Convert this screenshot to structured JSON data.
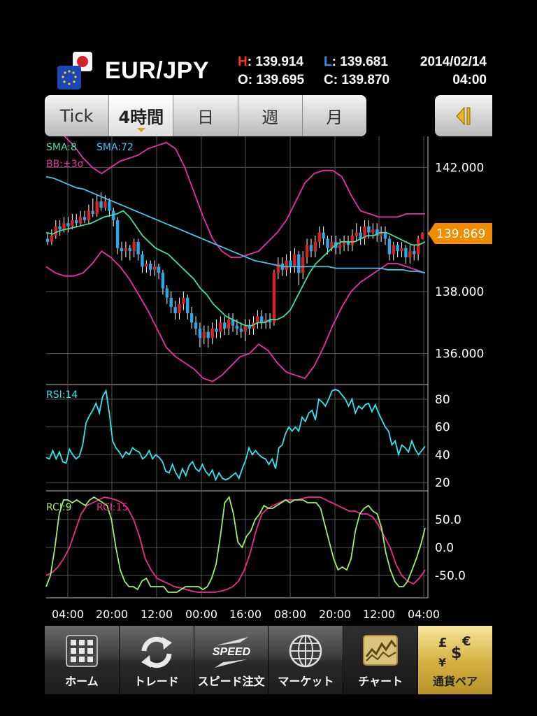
{
  "header": {
    "pair": "EUR/JPY",
    "high_key": "H",
    "high_value": ": 139.914",
    "low_key": "L",
    "low_value": ": 139.681",
    "open_key": "O",
    "open_value": ": 139.695",
    "close_key": "C",
    "close_value": ": 139.870",
    "date": "2014/02/14",
    "time": "04:00",
    "colors": {
      "high": "#ff2a2a",
      "low": "#2a8cff"
    }
  },
  "tabs": [
    {
      "label": "Tick",
      "active": false
    },
    {
      "label": "4時間",
      "active": true
    },
    {
      "label": "日",
      "active": false
    },
    {
      "label": "週",
      "active": false
    },
    {
      "label": "月",
      "active": false
    }
  ],
  "side_button_icon": "collapse-left-icon",
  "chart_data": [
    {
      "type": "candlestick",
      "panel": "price",
      "legend": [
        "SMA:8",
        "SMA:72",
        "BB:±3σ"
      ],
      "legend_colors": [
        "#3fe0a0",
        "#46c4ee",
        "#ee2ea8"
      ],
      "ylim": [
        135.0,
        143.0
      ],
      "yticks": [
        136.0,
        138.0,
        142.0
      ],
      "ytick_labels": [
        "136.000",
        "138.000",
        "142.000"
      ],
      "current_price": "139.869",
      "current_value": 139.869,
      "candles": [
        [
          139.7,
          139.6,
          139.9,
          139.5
        ],
        [
          139.6,
          139.8,
          140.0,
          139.5
        ],
        [
          139.8,
          140.1,
          140.3,
          139.7
        ],
        [
          140.1,
          140.0,
          140.3,
          139.8
        ],
        [
          140.0,
          140.2,
          140.4,
          139.9
        ],
        [
          140.2,
          140.1,
          140.4,
          139.9
        ],
        [
          140.1,
          140.3,
          140.5,
          140.0
        ],
        [
          140.3,
          140.2,
          140.5,
          140.1
        ],
        [
          140.2,
          140.4,
          140.6,
          140.1
        ],
        [
          140.4,
          140.3,
          140.6,
          140.2
        ],
        [
          140.3,
          140.6,
          140.8,
          140.2
        ],
        [
          140.6,
          140.5,
          141.0,
          140.4
        ],
        [
          140.5,
          140.9,
          141.1,
          140.4
        ],
        [
          140.9,
          140.7,
          141.2,
          140.6
        ],
        [
          140.7,
          140.9,
          141.1,
          140.6
        ],
        [
          140.9,
          140.6,
          141.0,
          140.4
        ],
        [
          140.6,
          140.3,
          140.7,
          140.1
        ],
        [
          140.3,
          139.4,
          140.4,
          139.2
        ],
        [
          139.4,
          139.3,
          139.6,
          139.0
        ],
        [
          139.3,
          139.4,
          139.6,
          139.1
        ],
        [
          139.4,
          139.3,
          139.5,
          139.0
        ],
        [
          139.3,
          139.6,
          139.7,
          139.1
        ],
        [
          139.6,
          139.2,
          139.7,
          139.0
        ],
        [
          139.2,
          138.8,
          139.3,
          138.6
        ],
        [
          138.8,
          138.9,
          139.0,
          138.6
        ],
        [
          138.9,
          138.7,
          139.0,
          138.5
        ],
        [
          138.7,
          138.8,
          139.0,
          138.5
        ],
        [
          138.8,
          138.6,
          138.9,
          138.4
        ],
        [
          138.6,
          138.1,
          138.7,
          137.9
        ],
        [
          138.1,
          137.8,
          138.2,
          137.6
        ],
        [
          137.8,
          137.5,
          138.0,
          137.3
        ],
        [
          137.5,
          137.3,
          137.7,
          137.1
        ],
        [
          137.3,
          137.6,
          137.8,
          137.1
        ],
        [
          137.6,
          137.8,
          138.0,
          137.4
        ],
        [
          137.8,
          137.3,
          137.9,
          137.1
        ],
        [
          137.3,
          137.0,
          137.5,
          136.8
        ],
        [
          137.0,
          136.8,
          137.2,
          136.6
        ],
        [
          136.8,
          136.5,
          137.0,
          136.2
        ],
        [
          136.5,
          136.7,
          136.9,
          136.3
        ],
        [
          136.7,
          136.5,
          136.9,
          136.2
        ],
        [
          136.5,
          136.8,
          137.0,
          136.3
        ],
        [
          136.8,
          136.7,
          137.1,
          136.5
        ],
        [
          136.7,
          137.0,
          137.2,
          136.5
        ],
        [
          137.0,
          136.8,
          137.2,
          136.6
        ],
        [
          136.8,
          137.1,
          137.3,
          136.6
        ],
        [
          137.1,
          136.9,
          137.3,
          136.7
        ],
        [
          136.9,
          136.8,
          137.1,
          136.6
        ],
        [
          136.8,
          136.7,
          137.0,
          136.5
        ],
        [
          136.7,
          136.9,
          137.1,
          136.4
        ],
        [
          136.9,
          136.8,
          137.1,
          136.6
        ],
        [
          136.8,
          137.0,
          137.2,
          136.6
        ],
        [
          137.0,
          137.2,
          137.4,
          136.8
        ],
        [
          137.2,
          137.0,
          137.4,
          136.8
        ],
        [
          137.0,
          137.1,
          137.3,
          136.8
        ],
        [
          137.1,
          137.0,
          137.3,
          136.8
        ],
        [
          137.0,
          138.6,
          138.7,
          136.9
        ],
        [
          138.6,
          138.9,
          139.1,
          138.4
        ],
        [
          138.9,
          138.7,
          139.1,
          138.5
        ],
        [
          138.7,
          139.0,
          139.2,
          138.5
        ],
        [
          139.0,
          138.8,
          139.3,
          138.6
        ],
        [
          138.8,
          139.2,
          139.4,
          138.6
        ],
        [
          139.2,
          138.6,
          139.3,
          138.2
        ],
        [
          138.6,
          139.1,
          139.3,
          138.4
        ],
        [
          139.1,
          139.5,
          139.7,
          138.9
        ],
        [
          139.5,
          139.3,
          139.7,
          139.1
        ],
        [
          139.3,
          139.6,
          139.8,
          139.1
        ],
        [
          139.6,
          139.9,
          140.1,
          139.4
        ],
        [
          139.9,
          139.7,
          140.1,
          139.5
        ],
        [
          139.7,
          139.4,
          139.8,
          139.2
        ],
        [
          139.4,
          139.6,
          139.8,
          139.3
        ],
        [
          139.6,
          139.4,
          139.8,
          139.2
        ],
        [
          139.4,
          139.5,
          139.7,
          139.2
        ],
        [
          139.5,
          139.6,
          139.8,
          139.3
        ],
        [
          139.6,
          139.5,
          139.8,
          139.3
        ],
        [
          139.5,
          139.8,
          140.0,
          139.3
        ],
        [
          139.8,
          139.9,
          140.2,
          139.6
        ],
        [
          139.9,
          139.7,
          140.1,
          139.5
        ],
        [
          139.7,
          140.1,
          140.3,
          139.5
        ],
        [
          140.1,
          139.9,
          140.3,
          139.7
        ],
        [
          139.9,
          140.0,
          140.2,
          139.7
        ],
        [
          140.0,
          139.8,
          140.2,
          139.6
        ],
        [
          139.8,
          139.9,
          140.1,
          139.6
        ],
        [
          139.9,
          139.7,
          140.1,
          139.5
        ],
        [
          139.7,
          139.2,
          139.8,
          139.0
        ],
        [
          139.2,
          139.5,
          139.6,
          139.0
        ],
        [
          139.5,
          139.3,
          139.6,
          139.1
        ],
        [
          139.3,
          139.4,
          139.6,
          139.1
        ],
        [
          139.4,
          139.1,
          139.5,
          138.9
        ],
        [
          139.1,
          139.3,
          139.5,
          138.9
        ],
        [
          139.3,
          139.2,
          139.5,
          139.0
        ],
        [
          139.2,
          139.7,
          139.8,
          139.0
        ],
        [
          139.7,
          139.87,
          139.91,
          139.68
        ]
      ],
      "sma8": [
        139.9,
        139.85,
        139.95,
        140.0,
        140.05,
        140.1,
        140.15,
        140.2,
        140.3,
        140.4,
        140.45,
        140.5,
        140.6,
        140.4,
        140.1,
        139.8,
        139.6,
        139.4,
        139.3,
        139.2,
        139.0,
        138.8,
        138.6,
        138.4,
        138.1,
        137.9,
        137.6,
        137.4,
        137.2,
        137.1,
        137.0,
        136.9,
        136.9,
        137.0,
        137.0,
        137.1,
        137.1,
        137.2,
        137.4,
        137.8,
        138.2,
        138.6,
        138.9,
        139.1,
        139.3,
        139.5,
        139.6,
        139.6,
        139.6,
        139.7,
        139.8,
        139.8,
        139.9,
        139.9,
        139.8,
        139.7,
        139.6,
        139.5,
        139.5,
        139.6
      ],
      "sma72": [
        141.7,
        141.65,
        141.55,
        141.45,
        141.35,
        141.3,
        141.2,
        141.1,
        141.0,
        140.9,
        140.8,
        140.7,
        140.6,
        140.5,
        140.4,
        140.3,
        140.2,
        140.1,
        140.0,
        139.9,
        139.8,
        139.7,
        139.6,
        139.5,
        139.4,
        139.3,
        139.2,
        139.1,
        139.0,
        138.95,
        138.9,
        138.85,
        138.8,
        138.8,
        138.8,
        138.8,
        138.8,
        138.8,
        138.8,
        138.75,
        138.75,
        138.75,
        138.75,
        138.75,
        138.75,
        138.75,
        138.7,
        138.7,
        138.7,
        138.65,
        138.65,
        138.6
      ],
      "bb_upper": [
        143.3,
        143.2,
        143.0,
        142.7,
        142.3,
        142.0,
        141.8,
        142.0,
        142.2,
        142.3,
        142.4,
        142.6,
        142.7,
        142.8,
        142.6,
        142.0,
        141.2,
        140.4,
        139.7,
        139.3,
        139.1,
        139.1,
        139.2,
        139.3,
        139.6,
        139.9,
        140.3,
        140.9,
        141.5,
        141.8,
        141.9,
        141.9,
        141.7,
        141.1,
        140.6,
        140.5,
        140.4,
        140.4,
        140.4,
        140.5,
        140.5,
        140.5
      ],
      "bb_lower": [
        138.8,
        138.6,
        138.5,
        138.5,
        138.6,
        138.9,
        139.3,
        139.1,
        138.8,
        138.4,
        137.9,
        137.4,
        136.8,
        136.2,
        135.9,
        135.7,
        135.5,
        135.2,
        135.1,
        135.3,
        135.6,
        135.9,
        136.0,
        136.3,
        136.1,
        135.7,
        135.4,
        135.3,
        135.2,
        135.6,
        136.2,
        136.9,
        137.5,
        138.0,
        138.3,
        138.5,
        138.7,
        138.9,
        138.9,
        138.8,
        138.7,
        138.6
      ]
    },
    {
      "type": "line",
      "panel": "rsi",
      "legend": [
        "RSI:14"
      ],
      "legend_colors": [
        "#2ee6f0"
      ],
      "ylim": [
        15,
        90
      ],
      "yticks": [
        20,
        40,
        60,
        80
      ],
      "ytick_labels": [
        "20",
        "40",
        "60",
        "80"
      ],
      "values": [
        38,
        37,
        43,
        37,
        42,
        35,
        34,
        44,
        40,
        37,
        39,
        47,
        63,
        68,
        72,
        77,
        70,
        82,
        86,
        70,
        50,
        45,
        42,
        38,
        42,
        40,
        45,
        43,
        42,
        37,
        39,
        43,
        37,
        40,
        38,
        35,
        28,
        27,
        33,
        27,
        23,
        30,
        25,
        32,
        35,
        30,
        28,
        33,
        28,
        25,
        29,
        22,
        27,
        23,
        22,
        23,
        25,
        27,
        23,
        30,
        36,
        45,
        40,
        43,
        40,
        38,
        37,
        33,
        37,
        30,
        45,
        47,
        55,
        60,
        57,
        60,
        57,
        67,
        64,
        70,
        72,
        65,
        80,
        78,
        75,
        80,
        86,
        87,
        86,
        83,
        80,
        75,
        80,
        70,
        75,
        73,
        76,
        77,
        71,
        76,
        70,
        65,
        60,
        57,
        47,
        50,
        40,
        47,
        45,
        42,
        50,
        44,
        40,
        43,
        46
      ]
    },
    {
      "type": "line",
      "panel": "rci",
      "legend": [
        "RCI:9",
        "RCI:15"
      ],
      "legend_colors": [
        "#9cf06a",
        "#ee2e8e"
      ],
      "ylim": [
        -90,
        100
      ],
      "yticks": [
        -50,
        0,
        50
      ],
      "ytick_labels": [
        "-50.0",
        "0.0",
        "50.0"
      ],
      "rci9": [
        -70,
        -50,
        0,
        60,
        85,
        85,
        80,
        85,
        80,
        75,
        85,
        90,
        85,
        80,
        75,
        50,
        0,
        -40,
        -60,
        -70,
        -70,
        -75,
        -60,
        -55,
        -70,
        -70,
        -70,
        -70,
        -80,
        -80,
        -80,
        -75,
        -70,
        -70,
        -70,
        -70,
        -75,
        -70,
        -55,
        -30,
        20,
        80,
        90,
        60,
        10,
        0,
        20,
        30,
        50,
        60,
        75,
        70,
        70,
        75,
        80,
        85,
        80,
        85,
        85,
        85,
        80,
        80,
        80,
        70,
        40,
        10,
        -20,
        -40,
        -35,
        -40,
        -20,
        30,
        60,
        70,
        75,
        65,
        60,
        35,
        -10,
        -40,
        -60,
        -70,
        -70,
        -60,
        -40,
        -20,
        5,
        35
      ],
      "rci15": [
        -50,
        -45,
        -35,
        -20,
        0,
        30,
        60,
        75,
        80,
        85,
        90,
        88,
        85,
        80,
        70,
        50,
        20,
        -20,
        -40,
        -55,
        -60,
        -65,
        -70,
        -72,
        -75,
        -78,
        -80,
        -80,
        -80,
        -80,
        -78,
        -75,
        -70,
        -60,
        -40,
        -10,
        30,
        60,
        70,
        75,
        80,
        85,
        85,
        85,
        88,
        90,
        90,
        90,
        85,
        80,
        75,
        70,
        65,
        65,
        60,
        60,
        55,
        40,
        20,
        0,
        -30,
        -50,
        -60,
        -65,
        -55,
        -40
      ]
    }
  ],
  "time_axis": [
    "04:00",
    "20:00",
    "12:00",
    "00:00",
    "16:00",
    "08:00",
    "20:00",
    "12:00",
    "04:00"
  ],
  "bottom_nav": [
    {
      "label": "ホーム",
      "icon": "grid-icon"
    },
    {
      "label": "トレード",
      "icon": "refresh-arrows-icon"
    },
    {
      "label": "スピード注文",
      "icon": "speed-arrows-icon"
    },
    {
      "label": "マーケット",
      "icon": "globe-icon"
    },
    {
      "label": "チャート",
      "icon": "chart-icon"
    },
    {
      "label": "通貨ペア",
      "icon": "currency-icon"
    }
  ]
}
